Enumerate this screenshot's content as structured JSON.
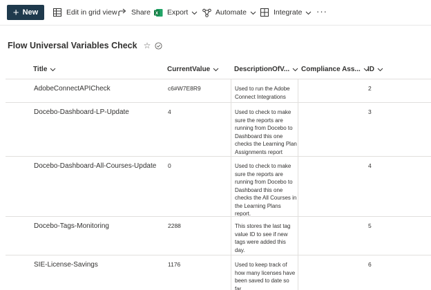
{
  "toolbar": {
    "new_label": "New",
    "edit_grid_label": "Edit in grid view",
    "share_label": "Share",
    "export_label": "Export",
    "automate_label": "Automate",
    "integrate_label": "Integrate",
    "more_label": "···"
  },
  "list": {
    "title": "Flow Universal Variables Check"
  },
  "columns": {
    "title": "Title",
    "current_value": "CurrentValue",
    "description": "DescriptionOfV...",
    "compliance": "Compliance Ass...",
    "id": "ID"
  },
  "rows": [
    {
      "title": "AdobeConnectAPICheck",
      "current_value": "c6#W7E8R9",
      "description": "Used to run the Adobe Connect Integrations",
      "compliance": "",
      "id": "2"
    },
    {
      "title": "Docebo-Dashboard-LP-Update",
      "current_value": "4",
      "description": "Used to check to make sure the reports are running from Docebo to Dashboard this one checks the Learning Plan Assignments report",
      "compliance": "",
      "id": "3"
    },
    {
      "title": "Docebo-Dashboard-All-Courses-Update",
      "current_value": "0",
      "description": "Used to check to make sure the reports are running from Docebo to Dashboard this one checks the All Courses in the Learning Plans report.",
      "compliance": "",
      "id": "4"
    },
    {
      "title": "Docebo-Tags-Monitoring",
      "current_value": "2288",
      "description": "This stores the last tag value ID to see if new tags were added this day.",
      "compliance": "",
      "id": "5"
    },
    {
      "title": "SIE-License-Savings",
      "current_value": "1176",
      "description": "Used to keep track of how many licenses have been saved to date so far.",
      "compliance": "",
      "id": "6"
    }
  ],
  "colors": {
    "new_button_bg": "#1f3a4d",
    "excel_green": "#107c41",
    "text": "#323130",
    "gridline": "#e1dfdd"
  },
  "icons": [
    "plus-icon",
    "grid-view-icon",
    "share-icon",
    "excel-icon",
    "automate-icon",
    "integrate-icon",
    "more-icon",
    "favorite-star-icon",
    "verified-icon",
    "chevron-down-icon"
  ]
}
